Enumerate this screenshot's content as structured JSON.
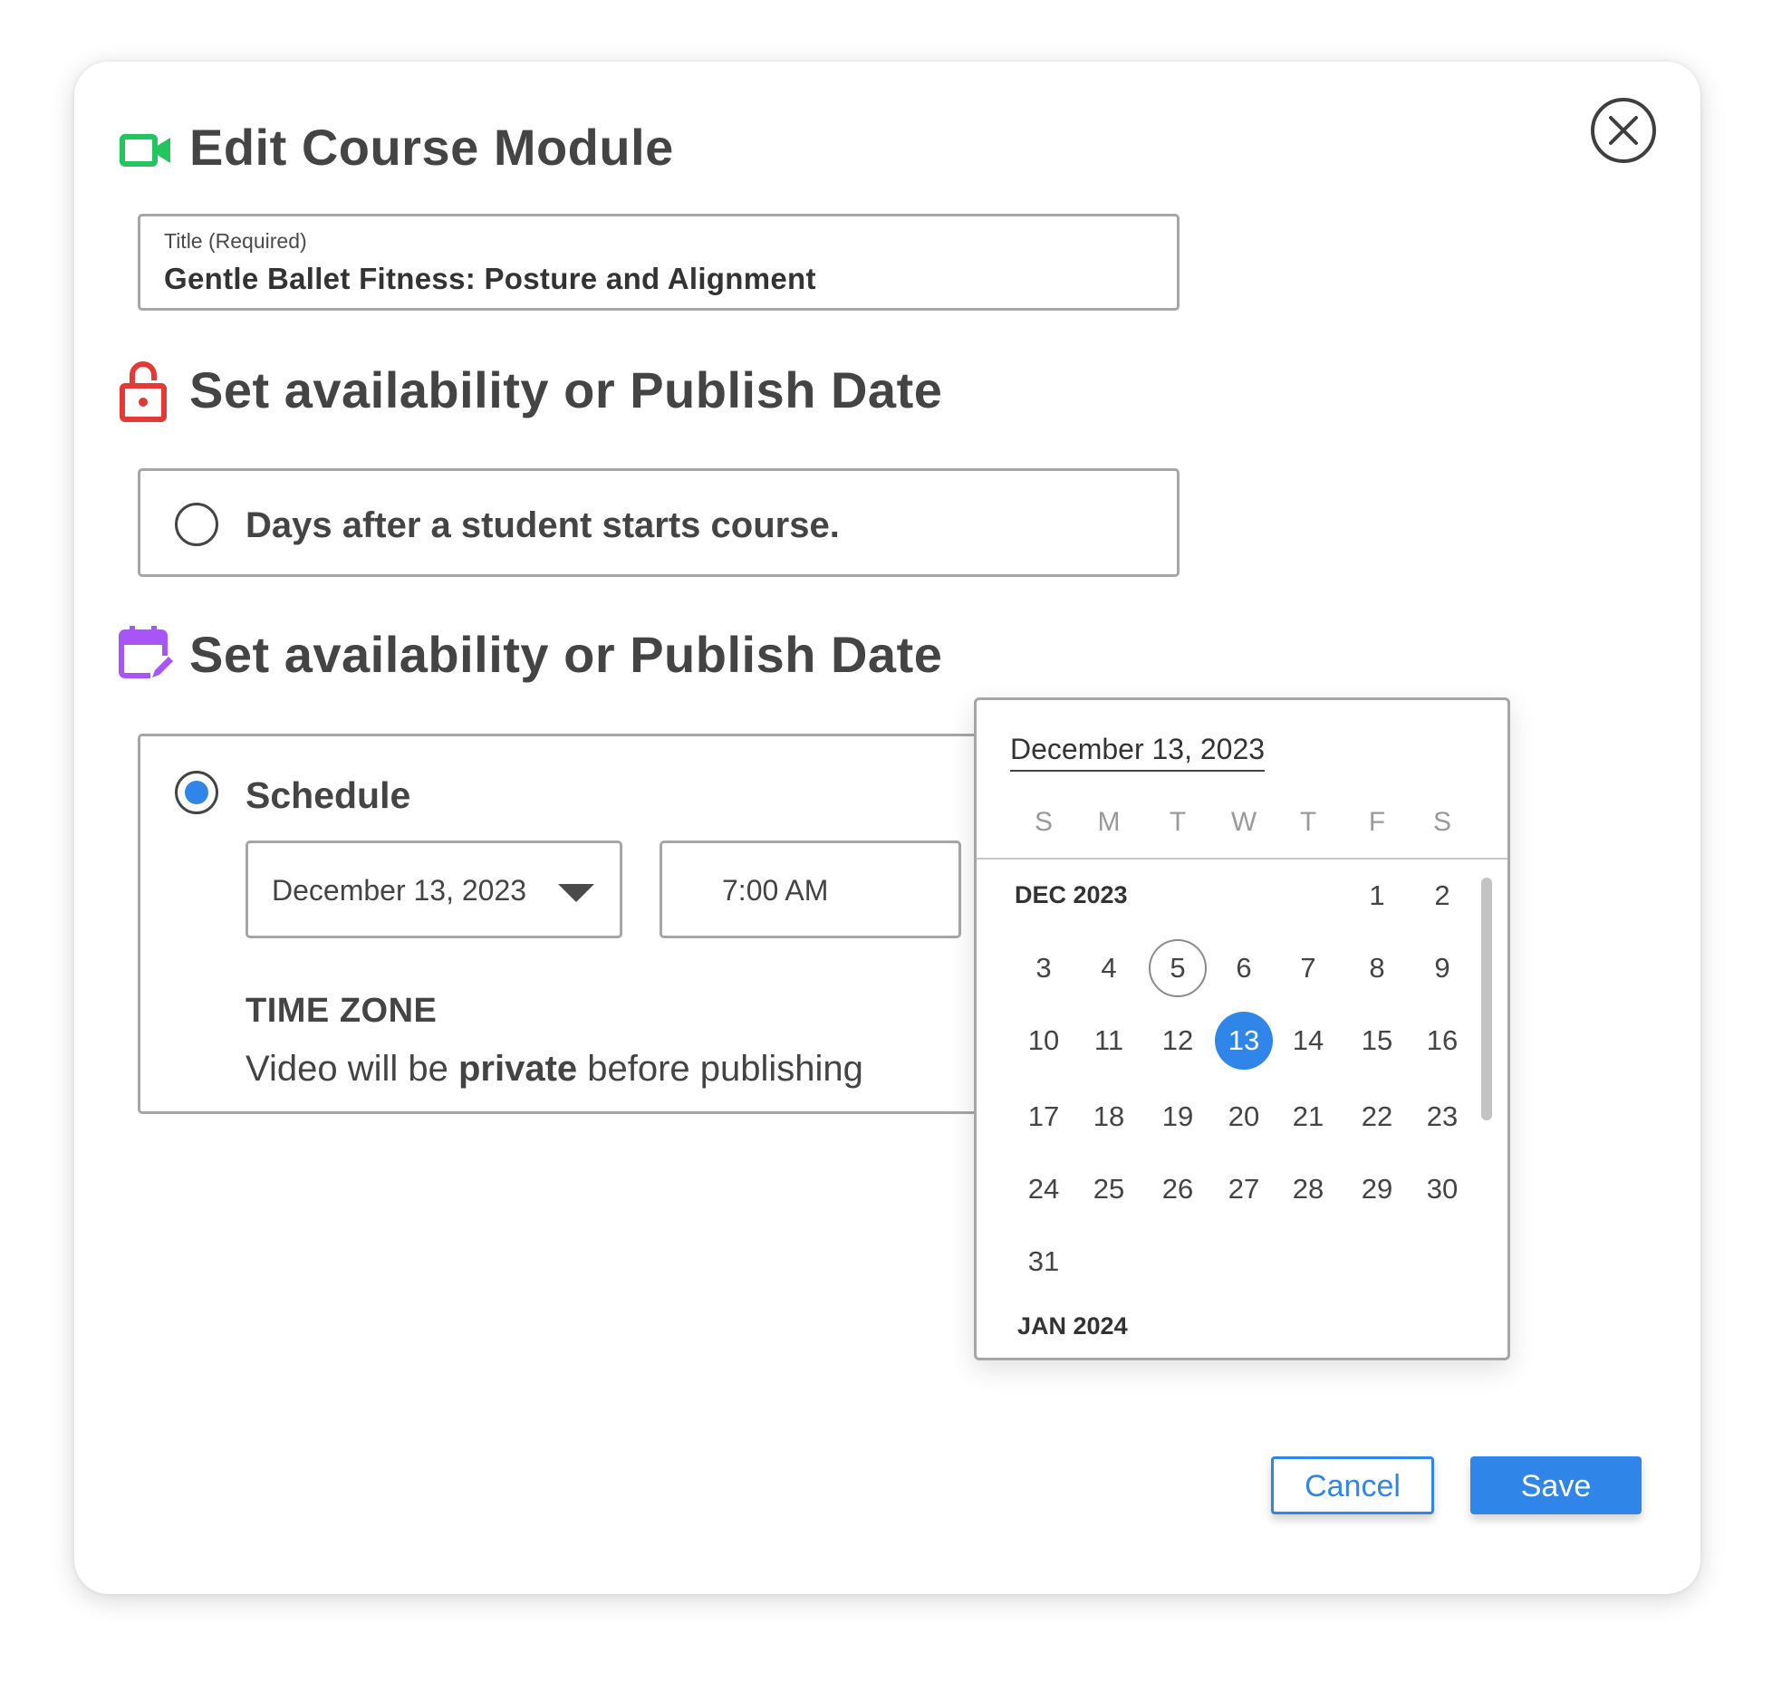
{
  "modal": {
    "title": "Edit Course Module",
    "title_icon": "video-camera-icon",
    "close_icon": "close-icon"
  },
  "title_field": {
    "label": "Title (Required)",
    "value": "Gentle Ballet Fitness: Posture and Alignment"
  },
  "availability_section": {
    "heading": "Set availability or Publish Date",
    "icon": "lock-open-icon",
    "option_label": "Days after a student starts course.",
    "option_selected": false
  },
  "publish_section": {
    "heading": "Set availability or Publish Date",
    "icon": "calendar-edit-icon",
    "schedule_label": "Schedule",
    "schedule_selected": true,
    "date_value": "December 13, 2023",
    "time_value": "7:00 AM",
    "timezone_label": "TIME ZONE",
    "note_prefix": "Video will be ",
    "note_bold": "private",
    "note_suffix": " before publishing"
  },
  "date_picker": {
    "selected_date_text": "December 13, 2023",
    "weekdays": [
      "S",
      "M",
      "T",
      "W",
      "T",
      "F",
      "S"
    ],
    "month_label": "DEC 2023",
    "next_month_label": "JAN 2024",
    "first_weekday_index": 5,
    "days_in_month": 31,
    "today_day": 5,
    "selected_day": 13
  },
  "colors": {
    "accent": "#2f86e8",
    "video_icon": "#22c55e",
    "lock_icon": "#e53935",
    "calendar_icon": "#a855f7"
  },
  "footer": {
    "cancel_label": "Cancel",
    "save_label": "Save"
  }
}
